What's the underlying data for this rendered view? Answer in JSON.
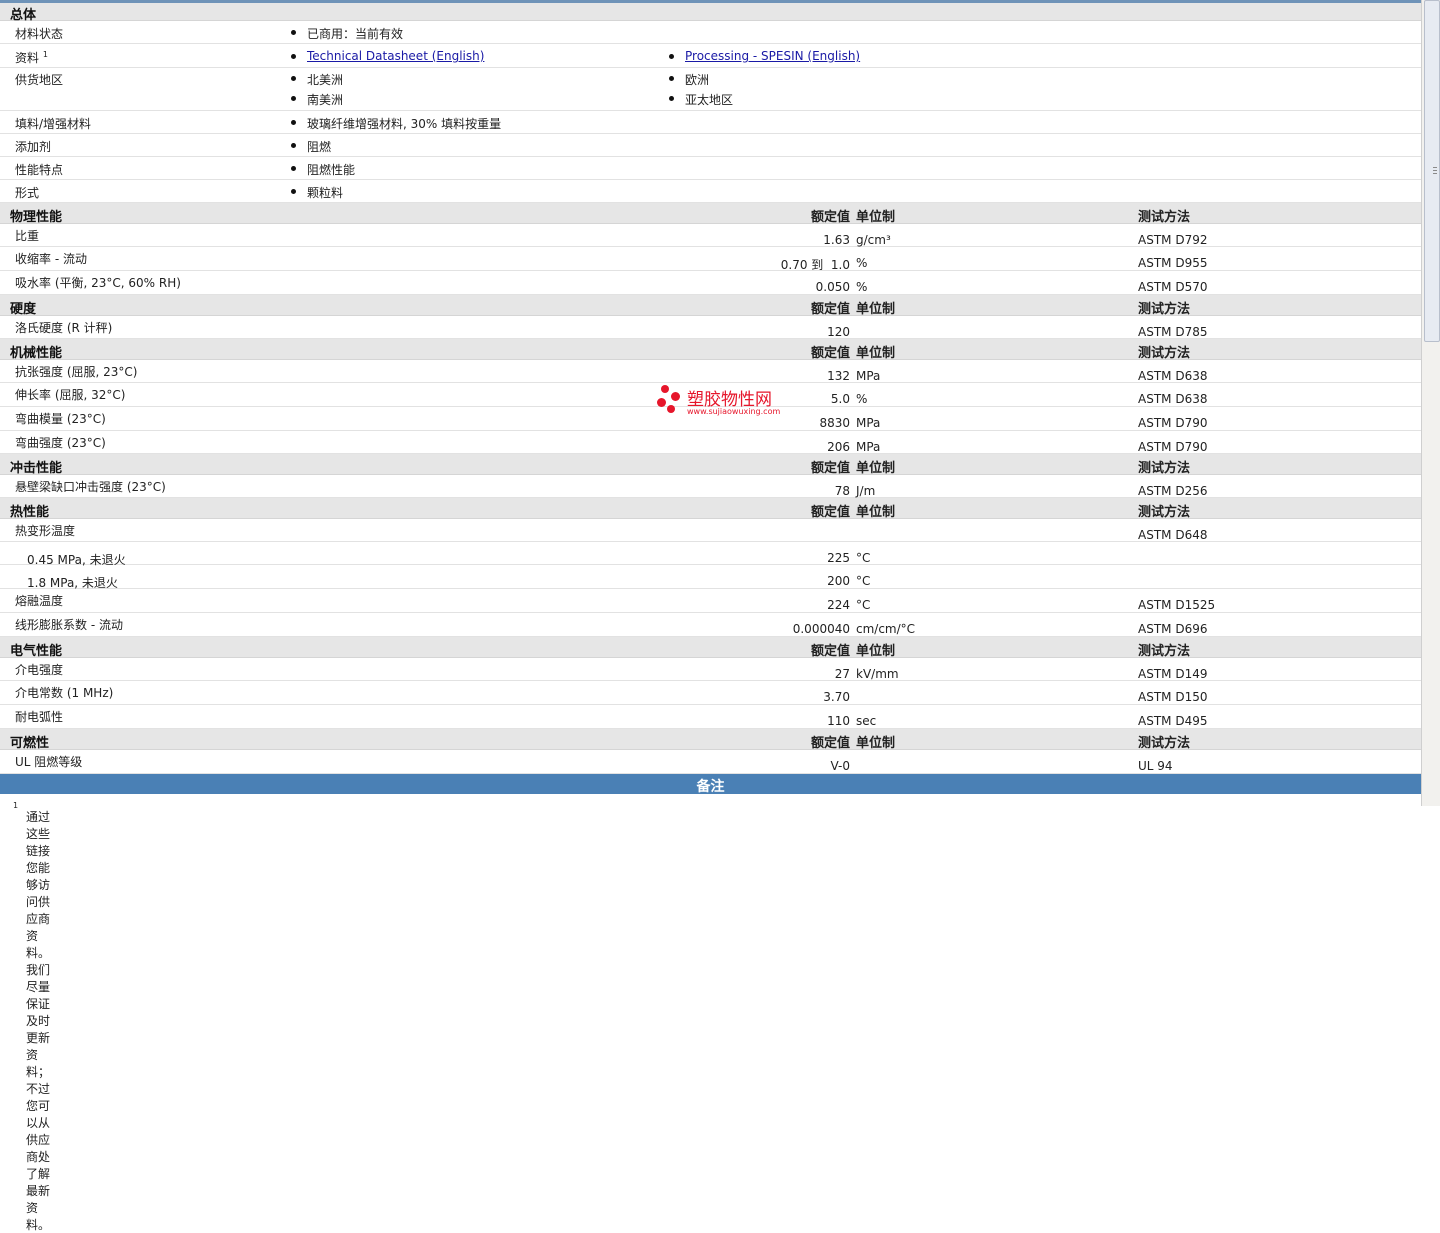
{
  "general": {
    "title": "总体",
    "rows": [
      {
        "label": "材料状态",
        "items": [
          "已商用：当前有效"
        ]
      },
      {
        "label": "资料",
        "sup": "1",
        "items": [
          "Technical Datasheet (English)",
          "Processing - SPESIN (English)"
        ]
      },
      {
        "label": "供货地区",
        "items": [
          "北美洲",
          "欧洲",
          "南美洲",
          "亚太地区"
        ]
      },
      {
        "label": "填料/增强材料",
        "items": [
          "玻璃纤维增强材料, 30% 填料按重量"
        ]
      },
      {
        "label": "添加剂",
        "items": [
          "阻燃"
        ]
      },
      {
        "label": "性能特点",
        "items": [
          "阻燃性能"
        ]
      },
      {
        "label": "形式",
        "items": [
          "颗粒料"
        ]
      }
    ]
  },
  "headers": {
    "nominal": "额定值",
    "unit": "单位制",
    "test": "测试方法"
  },
  "sections": [
    {
      "title": "物理性能",
      "rows": [
        {
          "label": "比重",
          "value": "1.63",
          "unit": "g/cm³",
          "test": "ASTM D792"
        },
        {
          "label": "收缩率 - 流动",
          "value": "0.70 到  1.0",
          "unit": "%",
          "test": "ASTM D955"
        },
        {
          "label": "吸水率 (平衡, 23°C, 60% RH)",
          "value": "0.050",
          "unit": "%",
          "test": "ASTM D570"
        }
      ]
    },
    {
      "title": "硬度",
      "rows": [
        {
          "label": "洛氏硬度 (R 计秤)",
          "value": "120",
          "unit": "",
          "test": "ASTM D785"
        }
      ]
    },
    {
      "title": "机械性能",
      "rows": [
        {
          "label": "抗张强度 (屈服, 23°C)",
          "value": "132",
          "unit": "MPa",
          "test": "ASTM D638"
        },
        {
          "label": "伸长率 (屈服, 32°C)",
          "value": "5.0",
          "unit": "%",
          "test": "ASTM D638"
        },
        {
          "label": "弯曲模量 (23°C)",
          "value": "8830",
          "unit": "MPa",
          "test": "ASTM D790"
        },
        {
          "label": "弯曲强度 (23°C)",
          "value": "206",
          "unit": "MPa",
          "test": "ASTM D790"
        }
      ]
    },
    {
      "title": "冲击性能",
      "rows": [
        {
          "label": "悬壁梁缺口冲击强度 (23°C)",
          "value": "78",
          "unit": "J/m",
          "test": "ASTM D256"
        }
      ]
    },
    {
      "title": "热性能",
      "rows": [
        {
          "label": "热变形温度",
          "value": "",
          "unit": "",
          "test": "ASTM D648"
        },
        {
          "label": "0.45 MPa, 未退火",
          "value": "225",
          "unit": "°C",
          "test": "",
          "sub": true
        },
        {
          "label": "1.8 MPa, 未退火",
          "value": "200",
          "unit": "°C",
          "test": "",
          "sub": true
        },
        {
          "label": "熔融温度",
          "value": "224",
          "unit": "°C",
          "test": "ASTM D1525"
        },
        {
          "label": "线形膨胀系数 - 流动",
          "value": "0.000040",
          "unit": "cm/cm/°C",
          "test": "ASTM D696"
        }
      ]
    },
    {
      "title": "电气性能",
      "rows": [
        {
          "label": "介电强度",
          "value": "27",
          "unit": "kV/mm",
          "test": "ASTM D149"
        },
        {
          "label": "介电常数 (1 MHz)",
          "value": "3.70",
          "unit": "",
          "test": "ASTM D150"
        },
        {
          "label": "耐电弧性",
          "value": "110",
          "unit": "sec",
          "test": "ASTM D495"
        }
      ]
    },
    {
      "title": "可燃性",
      "rows": [
        {
          "label": "UL 阻燃等级",
          "value": "V-0",
          "unit": "",
          "test": "UL 94"
        }
      ]
    }
  ],
  "notes": {
    "title": "备注",
    "footnote_num": "1",
    "footnote_text": "通过这些链接您能够访问供应商资料。我们尽量保证及时更新资料；不过您可以从供应商处了解最新资料。"
  },
  "watermark": {
    "name": "塑胶物性网",
    "url": "www.sujiaowuxing.com"
  },
  "colors": {
    "section_bg": "#e6e6e6",
    "notes_bg": "#4a80b5",
    "link": "#1a1aa6",
    "watermark": "#e6162b"
  }
}
